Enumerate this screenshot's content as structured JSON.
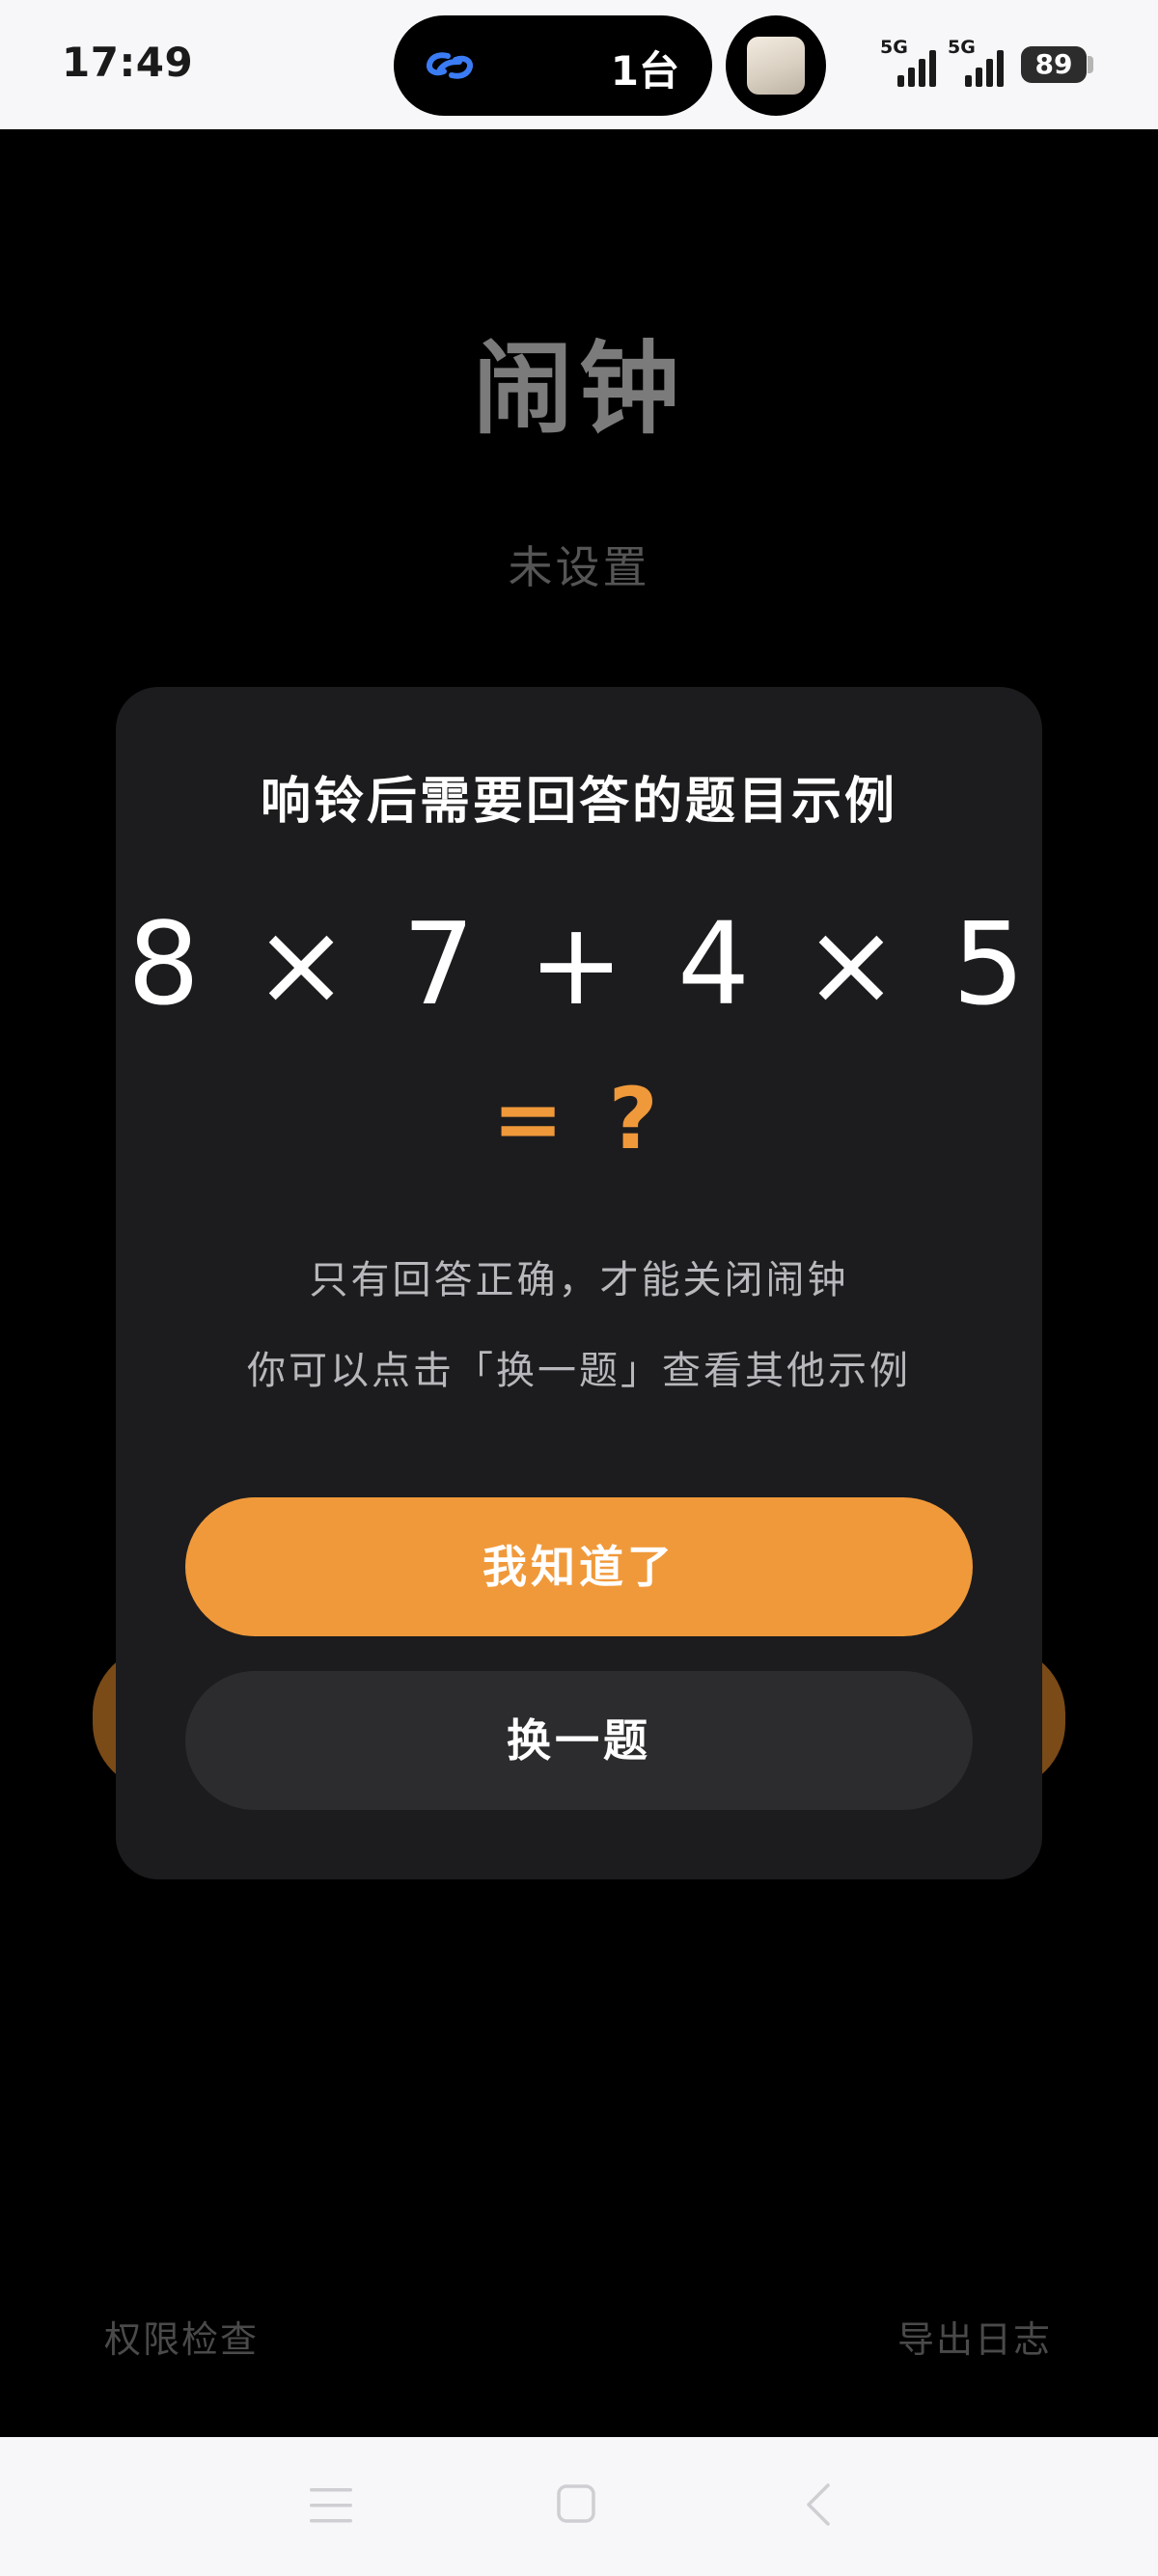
{
  "status_bar": {
    "time": "17:49",
    "island_device_count": "1台",
    "network_1": "5G",
    "network_2": "5G",
    "battery": "89"
  },
  "app": {
    "title": "闹钟",
    "subtitle": "未设置",
    "permissions_link": "权限检查",
    "export_logs_link": "导出日志"
  },
  "dialog": {
    "title": "响铃后需要回答的题目示例",
    "equation": "8 × 7 + 4 × 5",
    "answer_prompt": "= ?",
    "hint_line1": "只有回答正确，才能关闭闹钟",
    "hint_line2": "你可以点击「换一题」查看其他示例",
    "confirm_button": "我知道了",
    "next_button": "换一题"
  },
  "colors": {
    "accent": "#f0993a",
    "dialog_bg": "#1c1c1e",
    "secondary_button_bg": "#2c2c2e"
  },
  "icons": {
    "island_left": "link-icon",
    "island_right": "media-thumbnail-icon",
    "nav_menu": "menu-icon",
    "nav_home": "home-icon",
    "nav_back": "back-icon"
  }
}
